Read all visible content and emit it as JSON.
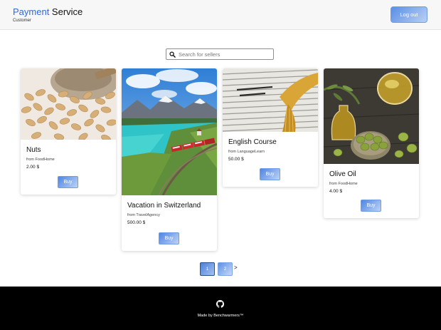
{
  "header": {
    "brand_accent": "Payment",
    "brand_rest": " Service",
    "subtitle": "Customer",
    "logout_label": "Log out"
  },
  "search": {
    "placeholder": "Search for sellers",
    "icon": "search-icon"
  },
  "products": [
    {
      "title": "Nuts",
      "seller": "from FoodHome",
      "price": "2.00 $",
      "buy_label": "Buy"
    },
    {
      "title": "Vacation in Switzerland",
      "seller": "from TravelAgency",
      "price": "500.00 $",
      "buy_label": "Buy"
    },
    {
      "title": "English Course",
      "seller": "from LanguageLearn",
      "price": "50.00 $",
      "buy_label": "Buy"
    },
    {
      "title": "Olive Oil",
      "seller": "from FoodHome",
      "price": "4.00 $",
      "buy_label": "Buy"
    }
  ],
  "pagination": {
    "pages": [
      "1",
      "2"
    ],
    "current": "1",
    "next_label": ">"
  },
  "footer": {
    "icon": "github-icon",
    "text": "Made by Benchwarmers™"
  },
  "colors": {
    "accent": "#2e6ad6",
    "button_from": "#4f86e3",
    "button_to": "#bcd3f5",
    "footer_bg": "#000000"
  }
}
